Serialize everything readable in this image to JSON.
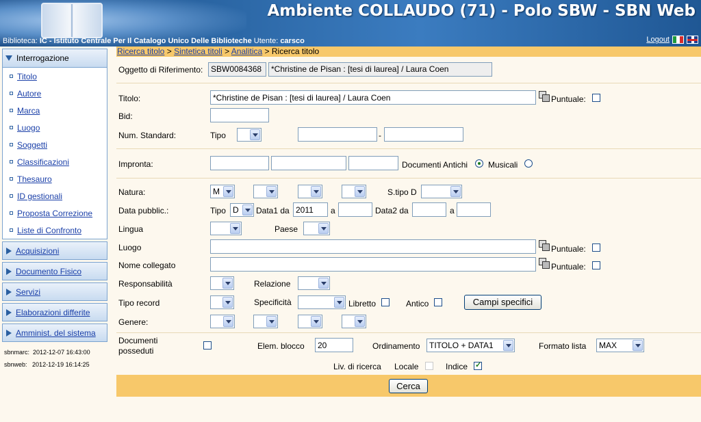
{
  "header": {
    "title": "Ambiente COLLAUDO (71) - Polo SBW - SBN Web",
    "biblioteca_label": "Biblioteca:",
    "biblioteca_value": "IC - Istituto Centrale Per Il Catalogo Unico Delle Biblioteche",
    "utente_label": "Utente:",
    "utente_value": "carsco",
    "logout": "Logout"
  },
  "sidebar": {
    "section_title": "Interrogazione",
    "items": [
      "Titolo",
      "Autore",
      "Marca",
      "Luogo",
      "Soggetti",
      "Classificazioni",
      "Thesauro",
      "ID gestionali",
      "Proposta Correzione",
      "Liste di Confronto"
    ],
    "groups": [
      "Acquisizioni",
      "Documento Fisico",
      "Servizi",
      "Elaborazioni differite",
      "Amminist. del sistema"
    ],
    "stamps": [
      {
        "label": "sbnmarc:",
        "value": "2012-12-07 16:43:00"
      },
      {
        "label": "sbnweb:",
        "value": "2012-12-19 16:14:25"
      }
    ]
  },
  "breadcrumb": {
    "links": [
      "Ricerca titolo",
      "Sintetica titoli",
      "Analitica"
    ],
    "separator": ">",
    "current": "Ricerca titolo"
  },
  "oggetto": {
    "label": "Oggetto di Riferimento:",
    "bid": "SBW0084368",
    "desc": "*Christine de Pisan : [tesi di laurea] / Laura Coen"
  },
  "form": {
    "titolo_label": "Titolo:",
    "titolo_value": "*Christine de Pisan : [tesi di laurea] / Laura Coen",
    "puntuale": "Puntuale:",
    "bid_label": "Bid:",
    "numstd_label": "Num. Standard:",
    "tipo_label": "Tipo",
    "dash": "-",
    "impronta_label": "Impronta:",
    "doc_antichi": "Documenti Antichi",
    "musicali": "Musicali",
    "natura_label": "Natura:",
    "natura_value": "M",
    "stipo_label": "S.tipo D",
    "data_label": "Data pubblic.:",
    "data_tipo": "D",
    "data1_label": "Data1 da",
    "data1_value": "2011",
    "a": "a",
    "data2_label": "Data2 da",
    "lingua_label": "Lingua",
    "paese_label": "Paese",
    "luogo_label": "Luogo",
    "nome_collegato_label": "Nome collegato",
    "responsabilita_label": "Responsabilità",
    "relazione_label": "Relazione",
    "tipo_record_label": "Tipo record",
    "specificita_label": "Specificità",
    "libretto_label": "Libretto",
    "antico_label": "Antico",
    "campi_specifici": "Campi specifici",
    "genere_label": "Genere:",
    "doc_posseduti_1": "Documenti",
    "doc_posseduti_2": "posseduti",
    "elem_blocco_label": "Elem. blocco",
    "elem_blocco_value": "20",
    "ordinamento_label": "Ordinamento",
    "ordinamento_value": "TITOLO + DATA1",
    "formato_label": "Formato lista",
    "formato_value": "MAX",
    "liv_ricerca": "Liv. di ricerca",
    "locale": "Locale",
    "indice": "Indice",
    "cerca": "Cerca"
  }
}
